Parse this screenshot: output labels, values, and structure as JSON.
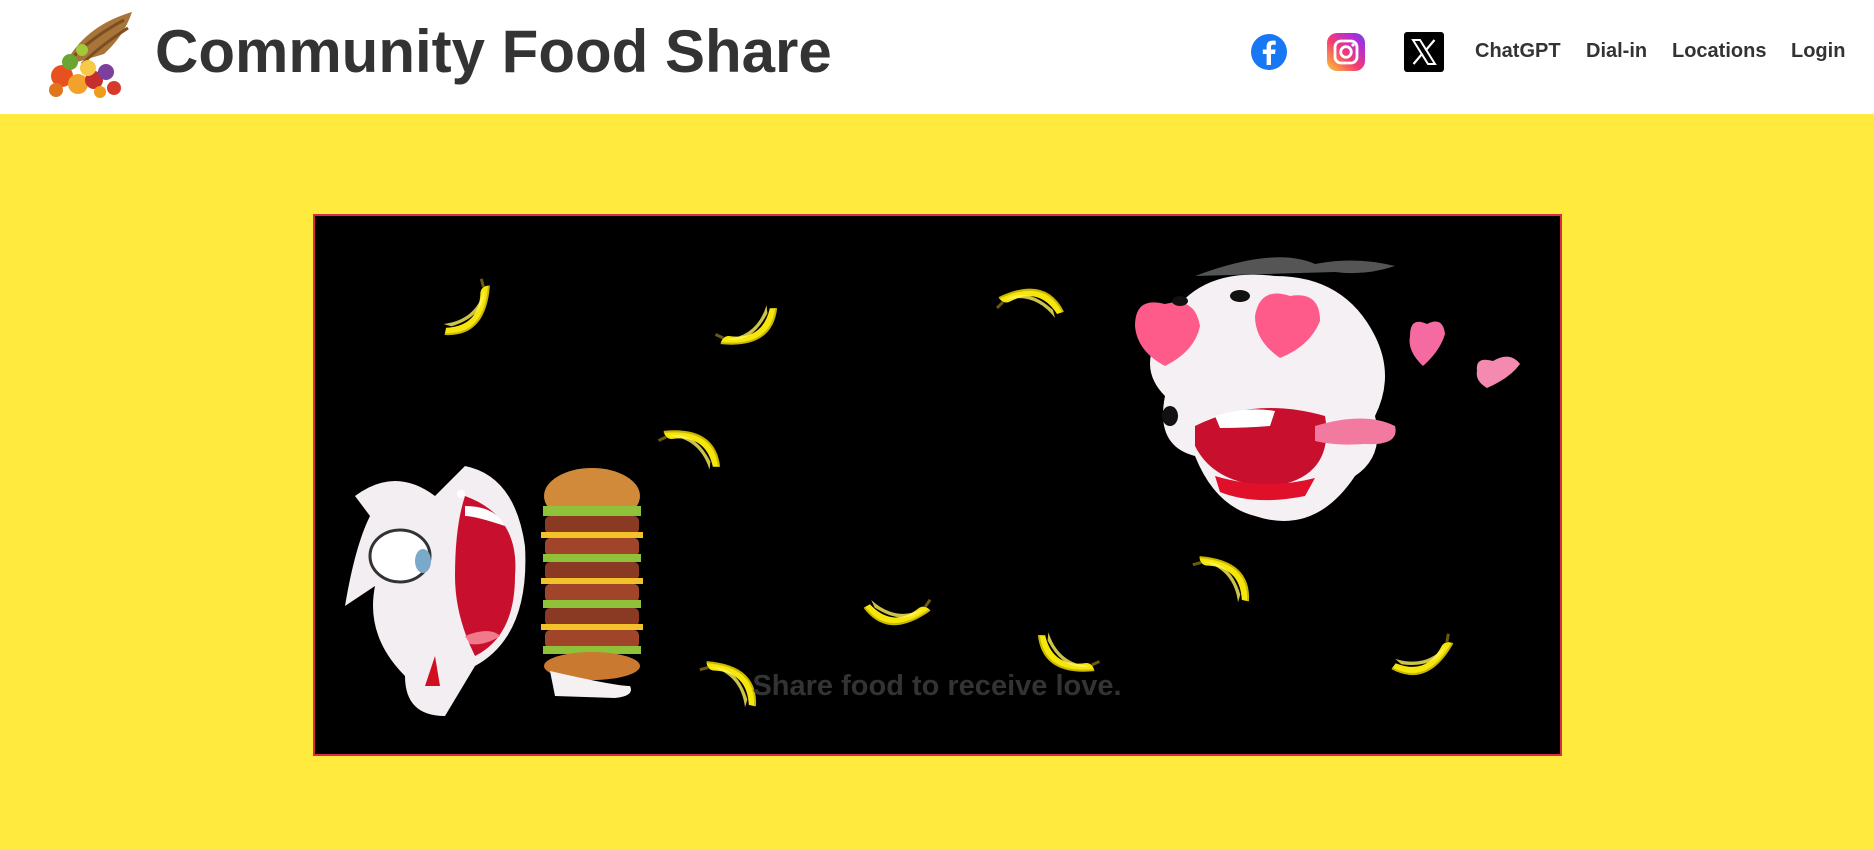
{
  "site": {
    "title": "Community Food Share",
    "logo_icon": "cornucopia-icon"
  },
  "nav": {
    "social": [
      {
        "name": "facebook-icon",
        "color": "#1877f2"
      },
      {
        "name": "instagram-icon",
        "color": "#d6249f"
      },
      {
        "name": "x-icon",
        "color": "#000000"
      }
    ],
    "links": [
      "ChatGPT",
      "Dial-in",
      "Locations",
      "Login"
    ]
  },
  "hero": {
    "background": "#000000",
    "illustration": "cartoon-characters-with-burger-and-bananas"
  },
  "tagline": "Share food to receive love.",
  "colors": {
    "page_background": "#ffea3d",
    "text": "#333333",
    "hero_border": "#d92c4a"
  }
}
